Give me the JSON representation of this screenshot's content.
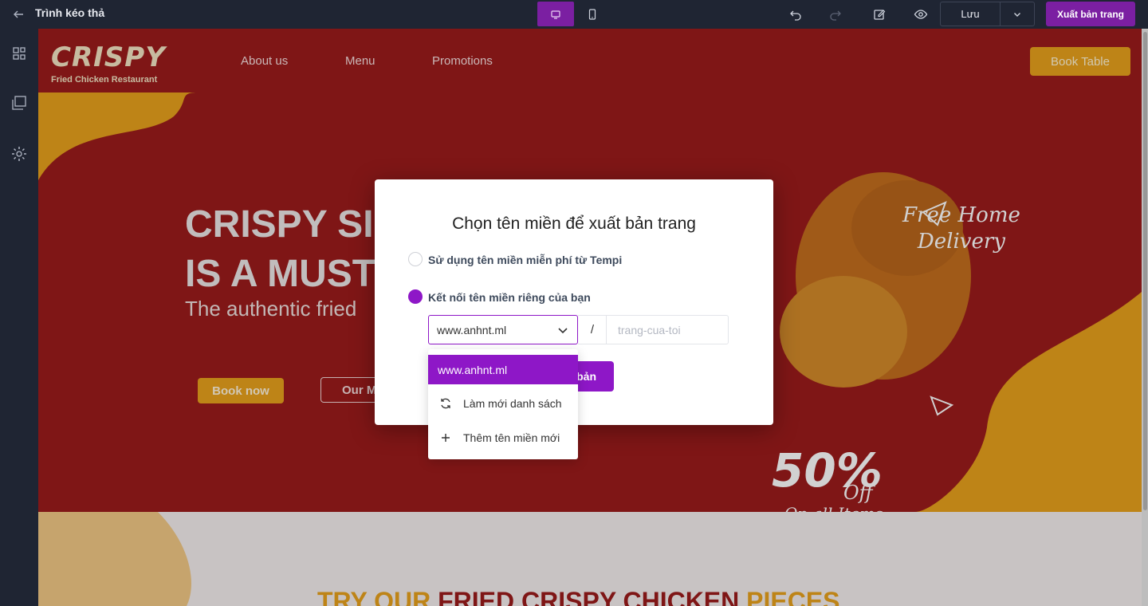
{
  "topbar": {
    "title": "Trình kéo thả",
    "save_label": "Lưu",
    "publish_label": "Xuất bản trang"
  },
  "site": {
    "logo": "CRISPY",
    "logo_sub": "Fried Chicken Restaurant",
    "nav": [
      "About us",
      "Menu",
      "Promotions"
    ],
    "book_table": "Book Table",
    "hero_line1": "CRISPY SI",
    "hero_line2": "IS A MUST",
    "hero_sub": "The authentic fried",
    "book_now": "Book now",
    "our_menu": "Our M",
    "free_delivery_1": "Free Home",
    "free_delivery_2": "Delivery",
    "promo_percent": "50%",
    "promo_off": "Off",
    "promo_on_all": "On all Items",
    "section_title_1": "TRY OUR",
    "section_title_2": "FRIED CRISPY CHICKEN",
    "section_title_3": "PIECES"
  },
  "modal": {
    "title": "Chọn tên miền để xuất bản trang",
    "option_free": "Sử dụng tên miền miễn phí từ Tempi",
    "option_custom": "Kết nối tên miền riêng của bạn",
    "selected_domain": "www.anhnt.ml",
    "slash": "/",
    "path_placeholder": "trang-cua-toi",
    "publish_label": "bản"
  },
  "dropdown": {
    "selected": "www.anhnt.ml",
    "refresh": "Làm mới danh sách",
    "add_new": "Thêm tên miền mới"
  },
  "colors": {
    "accent": "#8e17c7",
    "topbar": "#1f2533",
    "brand_red": "#9b1c1c",
    "brand_yellow": "#e8a21d"
  }
}
